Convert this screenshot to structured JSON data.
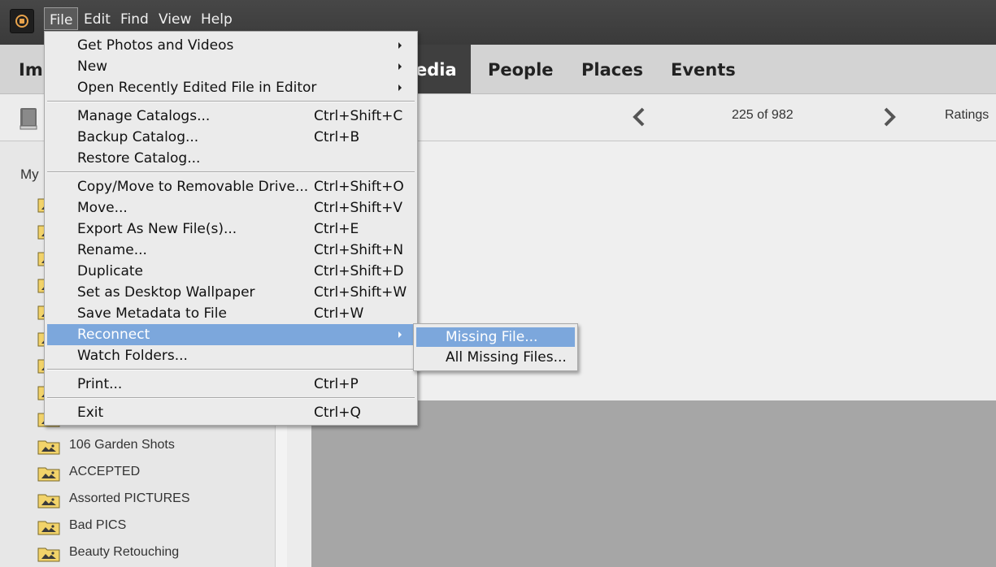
{
  "menubar": {
    "items": [
      "File",
      "Edit",
      "Find",
      "View",
      "Help"
    ],
    "open_item": "File"
  },
  "nav": {
    "tabs": [
      "Im",
      "edia",
      "People",
      "Places",
      "Events"
    ],
    "active_tab": "edia"
  },
  "toolbar": {
    "counter": "225 of 982",
    "ratings_label": "Ratings"
  },
  "sidebar": {
    "heading": "My",
    "folders": [
      "106 Garden Shots",
      "ACCEPTED",
      "Assorted PICTURES",
      "Bad PICS",
      "Beauty Retouching"
    ]
  },
  "file_menu": {
    "items": [
      {
        "label": "Get Photos and Videos",
        "shortcut": "",
        "submenu": true
      },
      {
        "label": "New",
        "shortcut": "",
        "submenu": true
      },
      {
        "label": "Open Recently Edited File in Editor",
        "shortcut": "",
        "submenu": true
      },
      {
        "label": "Manage Catalogs...",
        "shortcut": "Ctrl+Shift+C"
      },
      {
        "label": "Backup Catalog...",
        "shortcut": "Ctrl+B"
      },
      {
        "label": "Restore Catalog...",
        "shortcut": ""
      },
      {
        "label": "Copy/Move to Removable Drive...",
        "shortcut": "Ctrl+Shift+O"
      },
      {
        "label": "Move...",
        "shortcut": "Ctrl+Shift+V"
      },
      {
        "label": "Export As New File(s)...",
        "shortcut": "Ctrl+E"
      },
      {
        "label": "Rename...",
        "shortcut": "Ctrl+Shift+N"
      },
      {
        "label": "Duplicate",
        "shortcut": "Ctrl+Shift+D"
      },
      {
        "label": "Set as Desktop Wallpaper",
        "shortcut": "Ctrl+Shift+W"
      },
      {
        "label": "Save Metadata to File",
        "shortcut": "Ctrl+W"
      },
      {
        "label": "Reconnect",
        "shortcut": "",
        "submenu": true,
        "highlighted": true
      },
      {
        "label": "Watch Folders...",
        "shortcut": ""
      },
      {
        "label": "Print...",
        "shortcut": "Ctrl+P"
      },
      {
        "label": "Exit",
        "shortcut": "Ctrl+Q"
      }
    ]
  },
  "reconnect_submenu": {
    "items": [
      {
        "label": "Missing File...",
        "highlighted": true
      },
      {
        "label": "All Missing Files..."
      }
    ]
  },
  "colors": {
    "menu_highlight": "#7ca7dc",
    "titlebar": "#404040",
    "active_tab_bg": "#3f3f3f"
  },
  "icons": [
    "app-logo-icon",
    "book-icon",
    "chevron-left-icon",
    "chevron-right-icon",
    "folder-icon",
    "submenu-arrow-icon"
  ]
}
